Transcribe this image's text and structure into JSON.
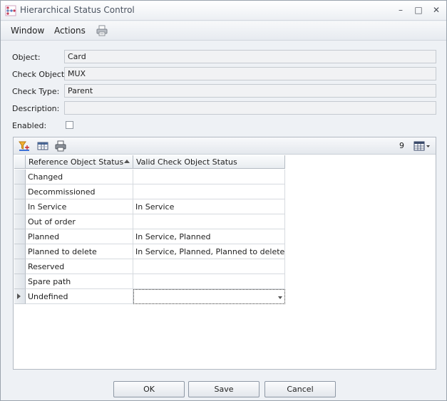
{
  "window": {
    "title": "Hierarchical Status Control",
    "minimize_glyph": "–",
    "maximize_glyph": "□",
    "close_glyph": "✕"
  },
  "menu": {
    "items": [
      "Window",
      "Actions"
    ],
    "print_icon": "printer-icon"
  },
  "form": {
    "object_label": "Object:",
    "object_value": "Card",
    "check_object_label": "Check Object:",
    "check_object_value": "MUX",
    "check_type_label": "Check Type:",
    "check_type_value": "Parent",
    "description_label": "Description:",
    "description_value": "",
    "enabled_label": "Enabled:",
    "enabled_checked": false
  },
  "grid_toolbar": {
    "icons": [
      "filter-icon",
      "columns-icon",
      "print-icon"
    ],
    "count": "9",
    "column_chooser_icon": "grid-options-icon"
  },
  "table": {
    "columns": [
      "Reference Object Status",
      "Valid Check Object Status"
    ],
    "sort_column": "Reference Object Status",
    "rows": [
      [
        "Changed",
        ""
      ],
      [
        "Decommissioned",
        ""
      ],
      [
        "In Service",
        "In Service"
      ],
      [
        "Out of order",
        ""
      ],
      [
        "Planned",
        "In Service, Planned"
      ],
      [
        "Planned to delete",
        "In Service, Planned, Planned to delete"
      ],
      [
        "Reserved",
        ""
      ],
      [
        "Spare path",
        ""
      ],
      [
        "Undefined",
        ""
      ]
    ],
    "current_row": 8
  },
  "buttons": {
    "ok": "OK",
    "save": "Save",
    "cancel": "Cancel"
  },
  "colors": {
    "accent": "#cc2a4a",
    "field_bg": "#f1f2f4",
    "window_bg": "#eef1f5"
  }
}
